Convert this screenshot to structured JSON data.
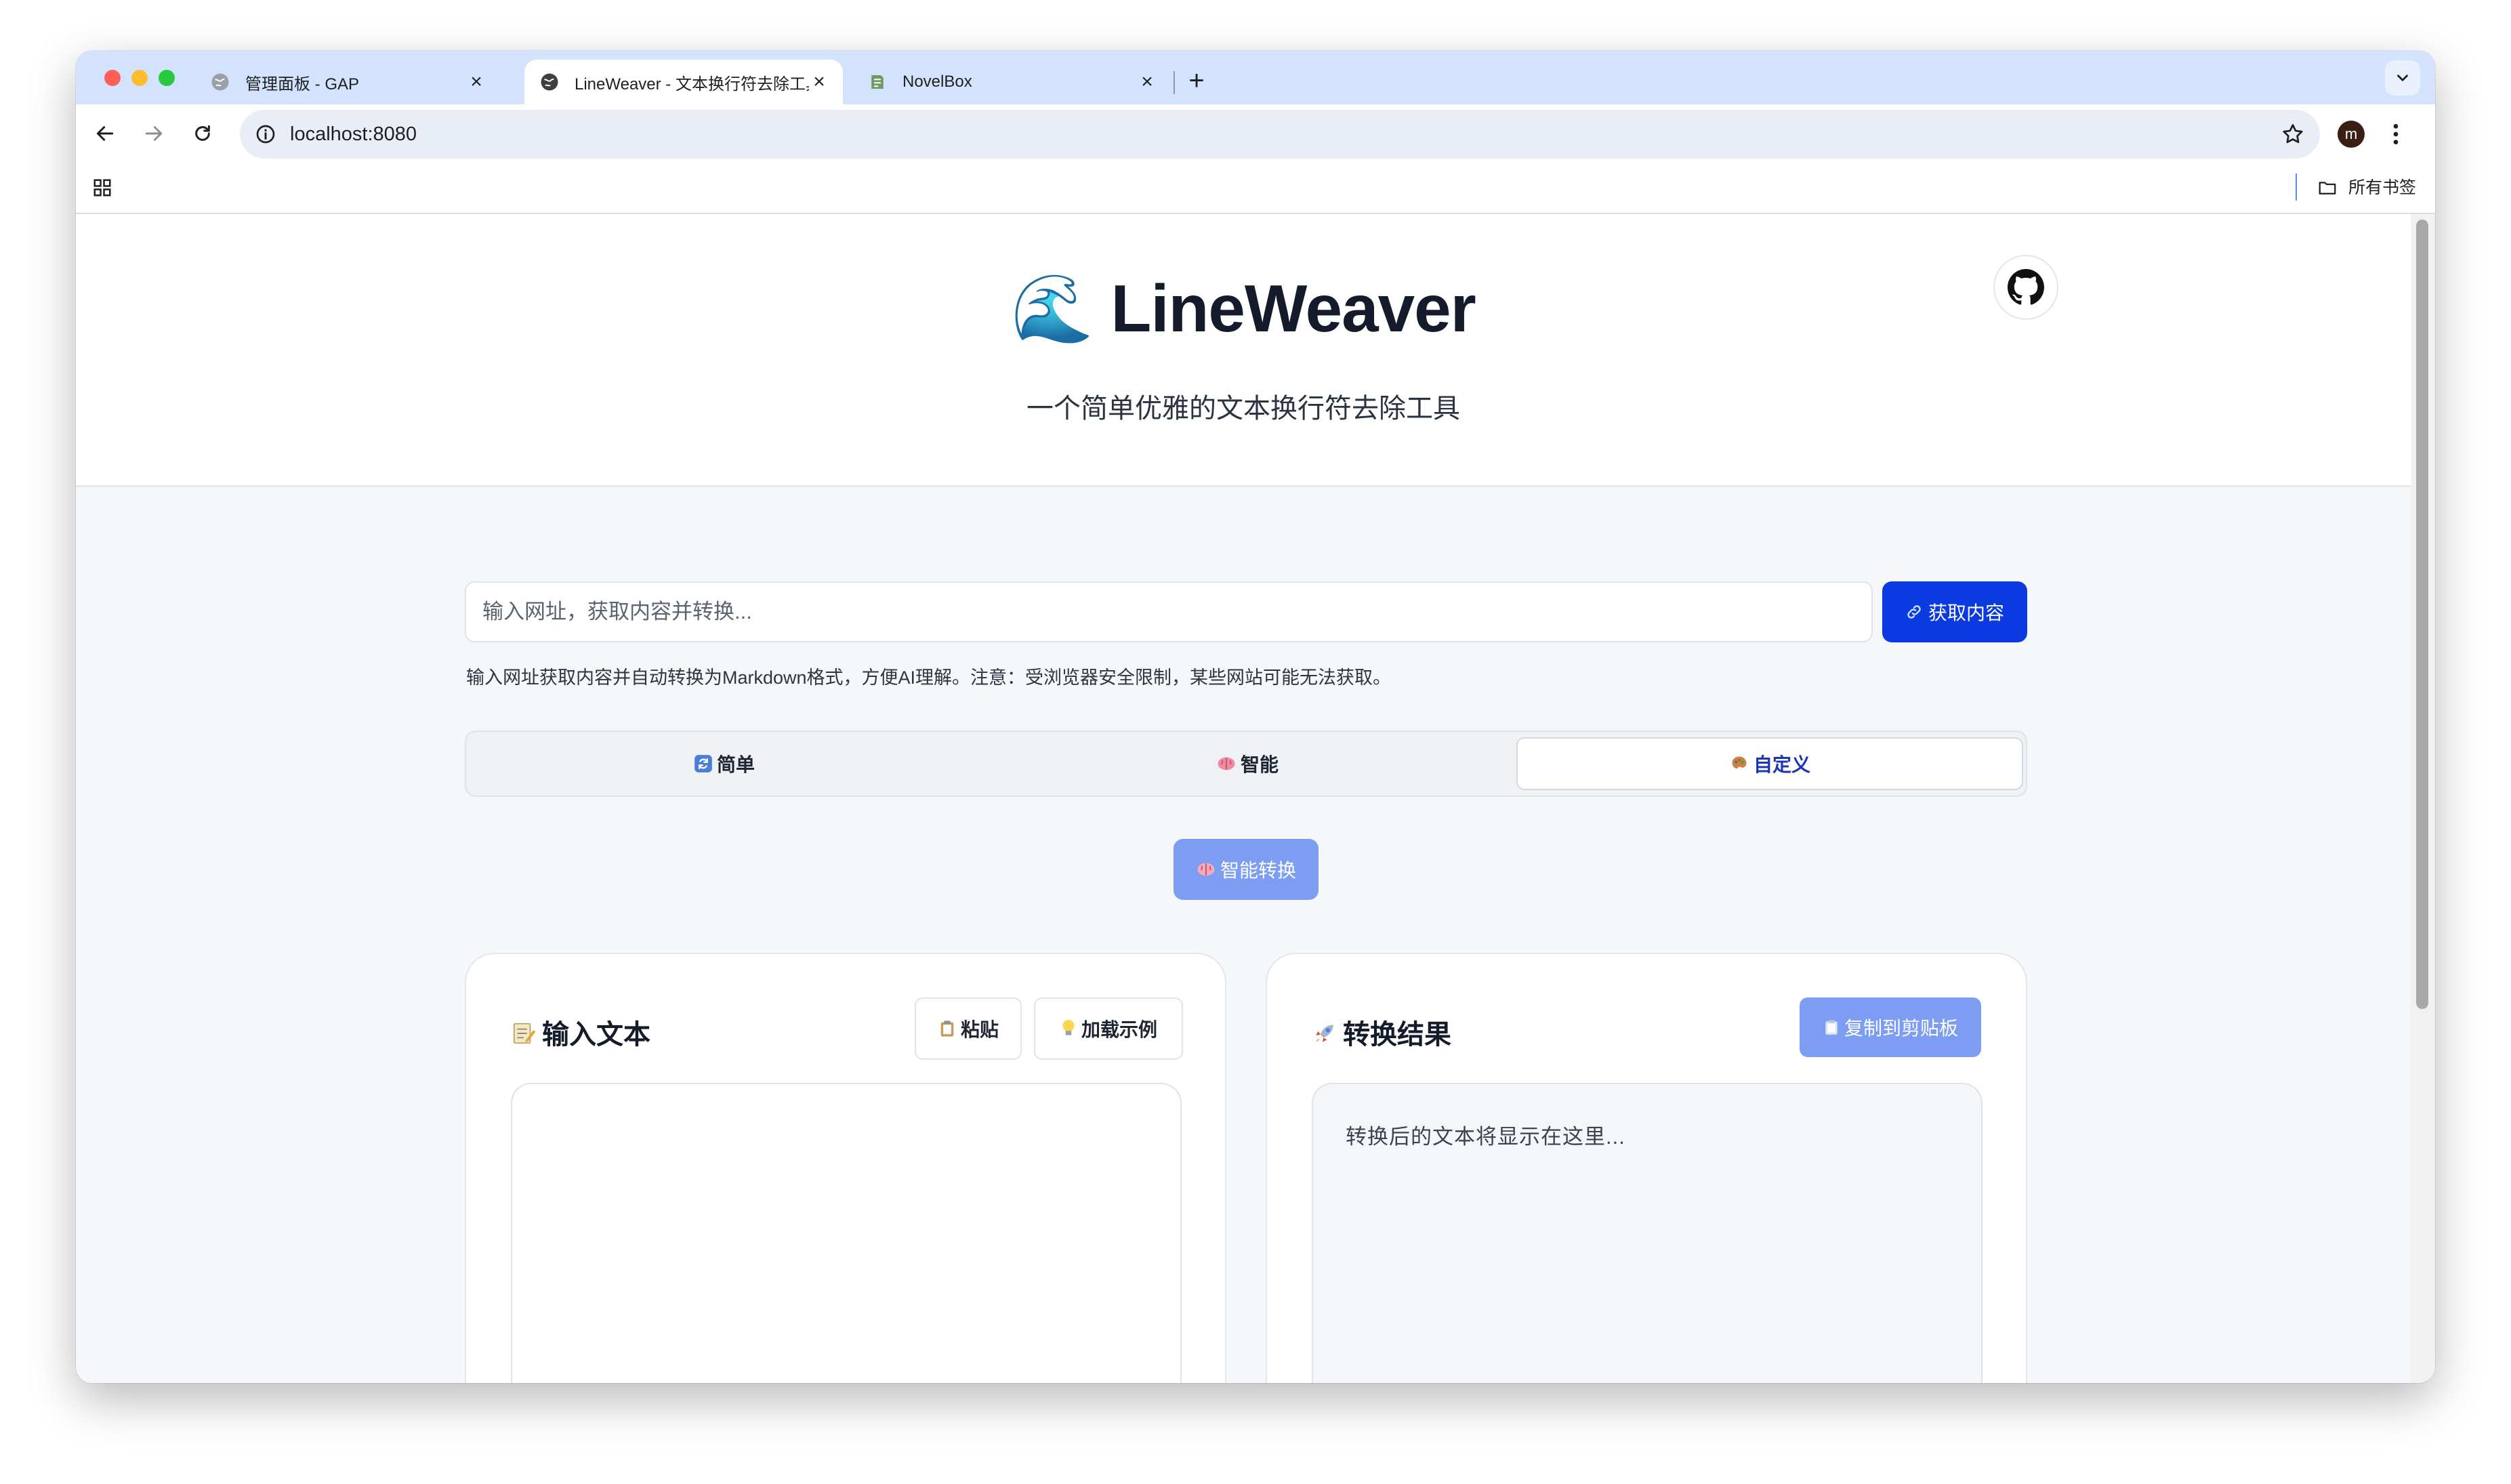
{
  "browser": {
    "tabs": [
      {
        "title": "管理面板 - GAP",
        "close": "×"
      },
      {
        "title": "LineWeaver - 文本换行符去除工具",
        "close": "×"
      },
      {
        "title": "NovelBox",
        "close": "×"
      }
    ],
    "new_tab": "+",
    "url": "localhost:8080",
    "avatar_letter": "m",
    "bookmarks_label": "所有书签"
  },
  "header": {
    "emoji": "🌊",
    "title": "LineWeaver",
    "subtitle": "一个简单优雅的文本换行符去除工具"
  },
  "fetch": {
    "placeholder": "输入网址，获取内容并转换...",
    "button": "获取内容",
    "hint": "输入网址获取内容并自动转换为Markdown格式，方便AI理解。注意：受浏览器安全限制，某些网站可能无法获取。"
  },
  "modes": [
    {
      "label": "简单",
      "active": false
    },
    {
      "label": "智能",
      "active": false
    },
    {
      "label": "自定义",
      "active": true
    }
  ],
  "convert_button": "智能转换",
  "input_panel": {
    "title": "输入文本",
    "paste_button": "粘贴",
    "example_button": "加载示例",
    "value": ""
  },
  "output_panel": {
    "title": "转换结果",
    "copy_button": "复制到剪贴板",
    "placeholder": "转换后的文本将显示在这里..."
  },
  "colors": {
    "tabstrip": "#d3e3fd",
    "primary": "#0b3be0",
    "primary_light": "#7c9df2",
    "page_bg": "#f5f7fb",
    "active_mode_text": "#1b35b8"
  }
}
